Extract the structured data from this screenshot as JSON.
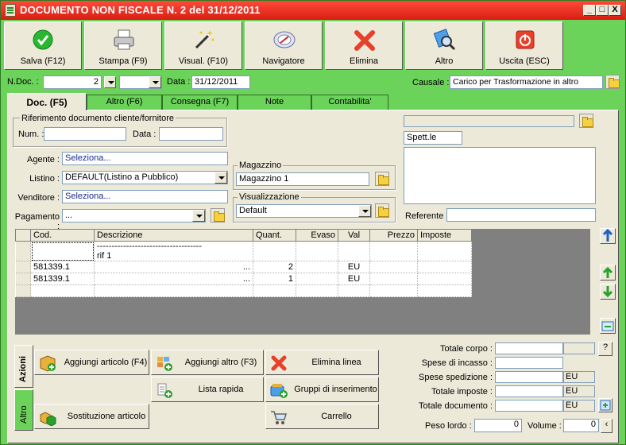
{
  "window": {
    "title": "DOCUMENTO NON FISCALE N. 2  del 31/12/2011",
    "controls": {
      "minimize": "_",
      "maximize": "□",
      "close": "X"
    }
  },
  "toolbar": [
    {
      "label": "Salva (F12)",
      "icon": "check-icon"
    },
    {
      "label": "Stampa (F9)",
      "icon": "printer-icon"
    },
    {
      "label": "Visual. (F10)",
      "icon": "magic-wand-icon"
    },
    {
      "label": "Navigatore",
      "icon": "compass-icon"
    },
    {
      "label": "Elimina",
      "icon": "delete-x-icon"
    },
    {
      "label": "Altro",
      "icon": "magnifier-icon"
    },
    {
      "label": "Uscita (ESC)",
      "icon": "power-icon"
    }
  ],
  "header": {
    "ndoc_label": "N.Doc. :",
    "ndoc_value": "2",
    "data_label": "Data :",
    "data_value": "31/12/2011",
    "causale_label": "Causale :",
    "causale_value": "Carico per Trasformazione in altro"
  },
  "tabs": [
    "Doc. (F5)",
    "Altro (F6)",
    "Consegna (F7)",
    "Note",
    "Contabilita'"
  ],
  "rif": {
    "group_title": "Riferimento documento cliente/fornitore",
    "num_label": "Num. :",
    "num_value": "",
    "data_label": "Data :",
    "data_value": ""
  },
  "form": {
    "agente_label": "Agente :",
    "agente_value": "Seleziona...",
    "listino_label": "Listino :",
    "listino_value": "DEFAULT(Listino a Pubblico)",
    "venditore_label": "Venditore :",
    "venditore_value": "Seleziona...",
    "pagamento_label": "Pagamento :",
    "pagamento_value": "..."
  },
  "magazzino": {
    "group_title": "Magazzino",
    "value": "Magazzino 1"
  },
  "visualizzazione": {
    "group_title": "Visualizzazione",
    "value": "Default"
  },
  "cliente": {
    "top_value": "",
    "spett": "Spett.le",
    "referente_label": "Referente",
    "referente_value": ""
  },
  "grid": {
    "columns": [
      "Cod.",
      "Descrizione",
      "Quant.",
      "Evaso",
      "Val",
      "Prezzo",
      "Imposte"
    ],
    "rows": [
      {
        "cod": "",
        "desc": "------------------------------------ rif 1",
        "more": "",
        "quant": "",
        "evaso": "",
        "val": "",
        "prezzo": "",
        "imposte": ""
      },
      {
        "cod": "581339.1",
        "desc": "",
        "more": "...",
        "quant": "2",
        "evaso": "",
        "val": "EU",
        "prezzo": "",
        "imposte": ""
      },
      {
        "cod": "581339.1",
        "desc": "",
        "more": "...",
        "quant": "1",
        "evaso": "",
        "val": "EU",
        "prezzo": "",
        "imposte": ""
      },
      {
        "cod": "",
        "desc": "",
        "more": "",
        "quant": "",
        "evaso": "",
        "val": "",
        "prezzo": "",
        "imposte": ""
      }
    ]
  },
  "side_tabs": [
    "Azioni",
    "Altro"
  ],
  "actions": {
    "aggiungi_articolo": "Aggiungi articolo (F4)",
    "aggiungi_altro": "Aggiungi altro (F3)",
    "elimina_linea": "Elimina linea",
    "lista_rapida": "Lista rapida",
    "gruppi_inserimento": "Gruppi di inserimento",
    "sostituzione": "Sostituzione articolo",
    "carrello": "Carrello"
  },
  "totals": {
    "totale_corpo": "Totale corpo :",
    "spese_incasso": "Spese di incasso :",
    "spese_spedizione": "Spese spedizione :",
    "totale_imposte": "Totale imposte :",
    "totale_documento": "Totale documento :",
    "currency": "EU",
    "help": "?",
    "peso_label": "Peso lordo :",
    "peso_value": "0",
    "volume_label": "Volume :",
    "volume_value": "0"
  }
}
